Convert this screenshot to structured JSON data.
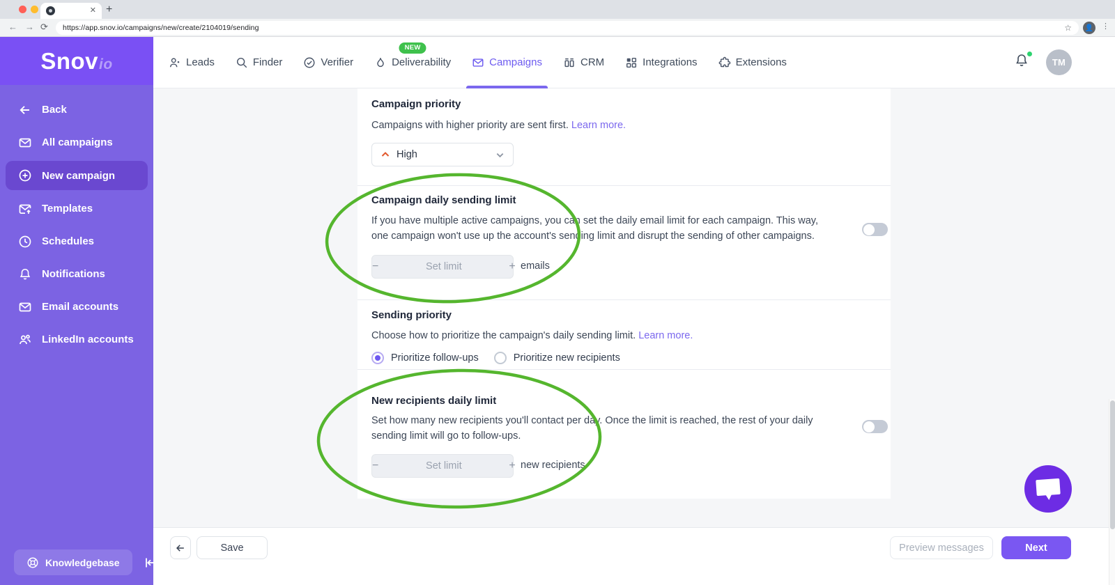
{
  "browser": {
    "url": "https://app.snov.io/campaigns/new/create/2104019/sending",
    "back_glyph": "←",
    "forward_glyph": "→",
    "reload_glyph": "⟳",
    "close_tab_glyph": "✕",
    "new_tab_glyph": "+",
    "star_glyph": "☆",
    "menu_dots_glyph": "⋮",
    "profile_glyph": "👤"
  },
  "brand": {
    "name": "Snov",
    "suffix": "io"
  },
  "header": {
    "nav": [
      {
        "label": "Leads"
      },
      {
        "label": "Finder"
      },
      {
        "label": "Verifier"
      },
      {
        "label": "Deliverability",
        "badge": "NEW"
      },
      {
        "label": "Campaigns",
        "active": true
      },
      {
        "label": "CRM"
      },
      {
        "label": "Integrations"
      },
      {
        "label": "Extensions"
      }
    ],
    "user_initials": "TM",
    "notification_dot_color": "#2dd36f"
  },
  "sidebar": {
    "items": [
      {
        "label": "Back"
      },
      {
        "label": "All campaigns"
      },
      {
        "label": "New campaign",
        "active": true
      },
      {
        "label": "Templates"
      },
      {
        "label": "Schedules"
      },
      {
        "label": "Notifications"
      },
      {
        "label": "Email accounts"
      },
      {
        "label": "LinkedIn accounts"
      }
    ],
    "knowledgebase_label": "Knowledgebase"
  },
  "sections": {
    "campaign_priority": {
      "title": "Campaign priority",
      "description": "Campaigns with higher priority are sent first.",
      "link": "Learn more.",
      "selected_value": "High"
    },
    "daily_limit": {
      "title": "Campaign daily sending limit",
      "description": "If you have multiple active campaigns, you can set the daily email limit for each campaign. This way, one campaign won't use up the account's sending limit and disrupt the sending of other campaigns.",
      "stepper_placeholder": "Set limit",
      "unit": "emails",
      "toggle_state": "off"
    },
    "sending_priority": {
      "title": "Sending priority",
      "description": "Choose how to prioritize the campaign's daily sending limit.",
      "link": "Learn more.",
      "options": [
        {
          "label": "Prioritize follow-ups",
          "selected": true
        },
        {
          "label": "Prioritize new recipients",
          "selected": false
        }
      ]
    },
    "new_recipients_limit": {
      "title": "New recipients daily limit",
      "description": "Set how many new recipients you'll contact per day. Once the limit is reached, the rest of your daily sending limit will go to follow-ups.",
      "stepper_placeholder": "Set limit",
      "unit": "new recipients",
      "toggle_state": "off"
    }
  },
  "stepper_glyphs": {
    "minus": "−",
    "plus": "+"
  },
  "footer": {
    "back_glyph": "←",
    "save_label": "Save",
    "preview_label": "Preview messages",
    "next_label": "Next"
  },
  "colors": {
    "accent_purple": "#6e58f1",
    "sidebar_purple": "#7c63e3",
    "sidebar_top_purple": "#7a50f4",
    "active_item_purple": "#6a48d0",
    "link_purple": "#7b68ee",
    "badge_green": "#3fc14c",
    "annotation_green": "#55b62e",
    "toggle_off_gray": "#c5cbd6",
    "chat_fab_purple": "#6d2ce4",
    "next_button_purple": "#7a57f2"
  }
}
